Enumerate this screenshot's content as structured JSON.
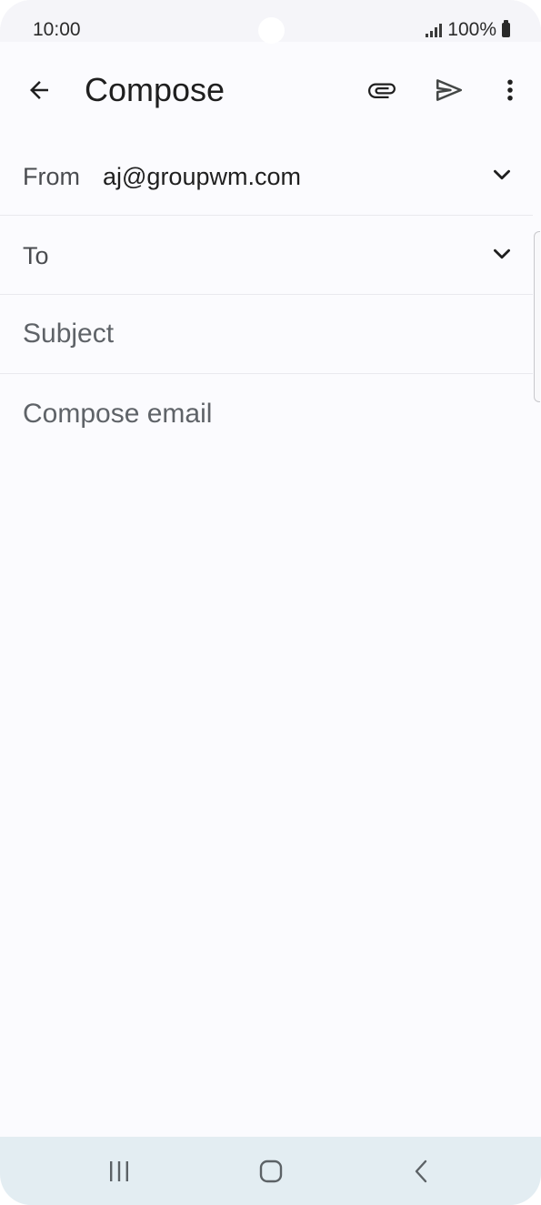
{
  "status_bar": {
    "time": "10:00",
    "battery": "100%",
    "signal_icon": "signal-icon",
    "battery_icon": "battery-icon"
  },
  "app_bar": {
    "title": "Compose",
    "back_icon": "arrow-left-icon",
    "attach_icon": "paperclip-icon",
    "send_icon": "send-icon",
    "more_icon": "more-vertical-icon"
  },
  "fields": {
    "from_label": "From",
    "from_value": "aj@groupwm.com",
    "to_label": "To",
    "subject_placeholder": "Subject",
    "body_placeholder": "Compose email"
  },
  "nav_bar": {
    "recent_icon": "recent-apps-icon",
    "home_icon": "home-icon",
    "back_icon": "back-icon"
  },
  "colors": {
    "background": "#fbfbfe",
    "status_bar": "#f5f5f9",
    "nav_bar": "#e3edf2",
    "text_primary": "#1f1f1f",
    "text_secondary": "#5f6368"
  }
}
